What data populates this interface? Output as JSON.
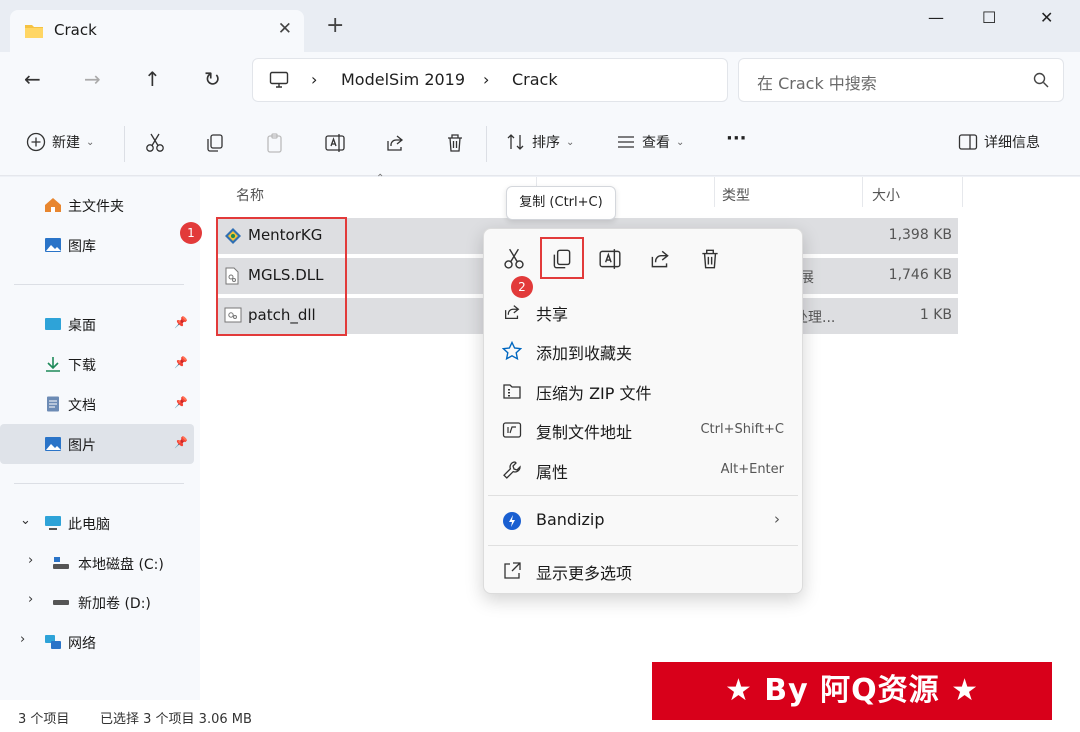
{
  "window": {
    "tab_title": "Crack",
    "tab_close": "✕",
    "new_tab": "+",
    "minimize": "—",
    "maximize": "☐",
    "close": "✕"
  },
  "nav": {
    "back": "←",
    "forward": "→",
    "up": "↑",
    "refresh": "↻",
    "breadcrumb": [
      "ModelSim 2019",
      "Crack"
    ],
    "sep": "›",
    "search_placeholder": "在 Crack 中搜索"
  },
  "toolbar": {
    "new_label": "新建",
    "sort_label": "排序",
    "view_label": "查看",
    "more": "···",
    "details_label": "详细信息"
  },
  "sidebar": {
    "home": "主文件夹",
    "gallery": "图库",
    "desktop": "桌面",
    "downloads": "下载",
    "documents": "文档",
    "pictures": "图片",
    "this_pc": "此电脑",
    "drive_c": "本地磁盘 (C:)",
    "drive_d": "新加卷 (D:)",
    "network": "网络"
  },
  "columns": {
    "name": "名称",
    "type": "类型",
    "size": "大小"
  },
  "files": [
    {
      "name": "MentorKG",
      "type": "",
      "size": "1,398 KB"
    },
    {
      "name": "MGLS.DLL",
      "type": "展",
      "size": "1,746 KB"
    },
    {
      "name": "patch_dll",
      "type": "处理...",
      "size": "1 KB"
    }
  ],
  "tooltip": "复制 (Ctrl+C)",
  "badges": {
    "one": "1",
    "two": "2"
  },
  "context_menu": {
    "share": "共享",
    "favorites": "添加到收藏夹",
    "zip": "压缩为 ZIP 文件",
    "copy_path": "复制文件地址",
    "copy_path_key": "Ctrl+Shift+C",
    "properties": "属性",
    "properties_key": "Alt+Enter",
    "bandizip": "Bandizip",
    "bandizip_arrow": "›",
    "more_options": "显示更多选项"
  },
  "status": {
    "count": "3 个项目",
    "selected": "已选择 3 个项目  3.06 MB"
  },
  "banner": "★ By 阿Q资源 ★",
  "colors": {
    "accent": "#0067c0",
    "highlight_red": "#e23a3a",
    "banner_red": "#d8001a"
  }
}
